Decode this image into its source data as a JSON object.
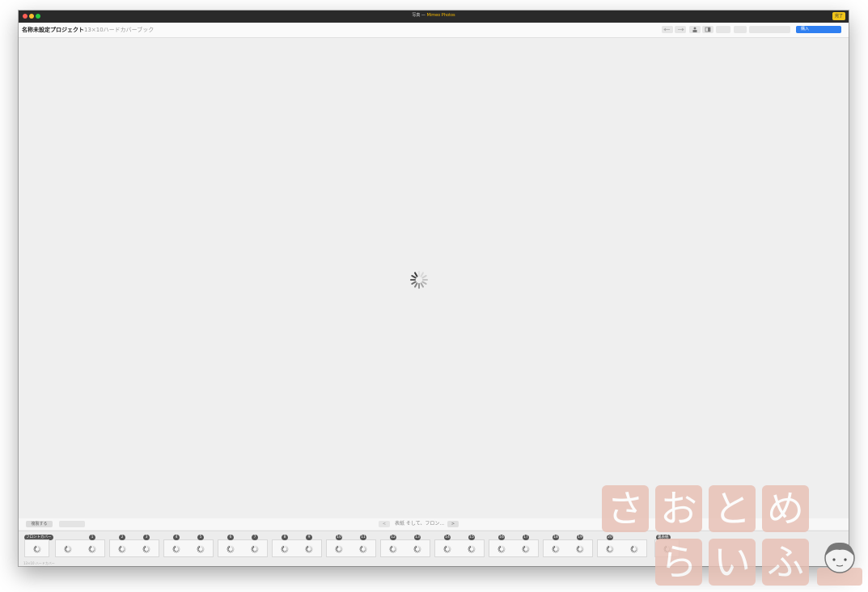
{
  "window": {
    "title_prefix": "写真 — ",
    "title_app": "Mimeo Photos",
    "done_label": "完了"
  },
  "toolbar": {
    "project_title": "名称未設定プロジェクト",
    "project_subtitle": "13×10ハードカバーブック",
    "buy_label": "購入"
  },
  "pager": {
    "left_button": "複製する",
    "prev_label": "<",
    "page_label": "表紙 そして、フロン...",
    "next_label": ">"
  },
  "strip": {
    "front_cover_label": "フロントカバー",
    "back_cover_label": "裏表紙",
    "page_numbers": [
      "1",
      "2",
      "3",
      "4",
      "5",
      "6",
      "7",
      "8",
      "9",
      "10",
      "11",
      "12",
      "13",
      "14",
      "15",
      "16",
      "17",
      "18",
      "19",
      "20"
    ],
    "footer": "13×10 ハードカバー"
  },
  "watermark": {
    "row1": [
      "さ",
      "お",
      "と",
      "め"
    ],
    "row2": [
      "ら",
      "い",
      "ふ"
    ]
  },
  "colors": {
    "accent": "#2f7ff1",
    "done": "#f0c419",
    "title_app": "#f5b800"
  }
}
